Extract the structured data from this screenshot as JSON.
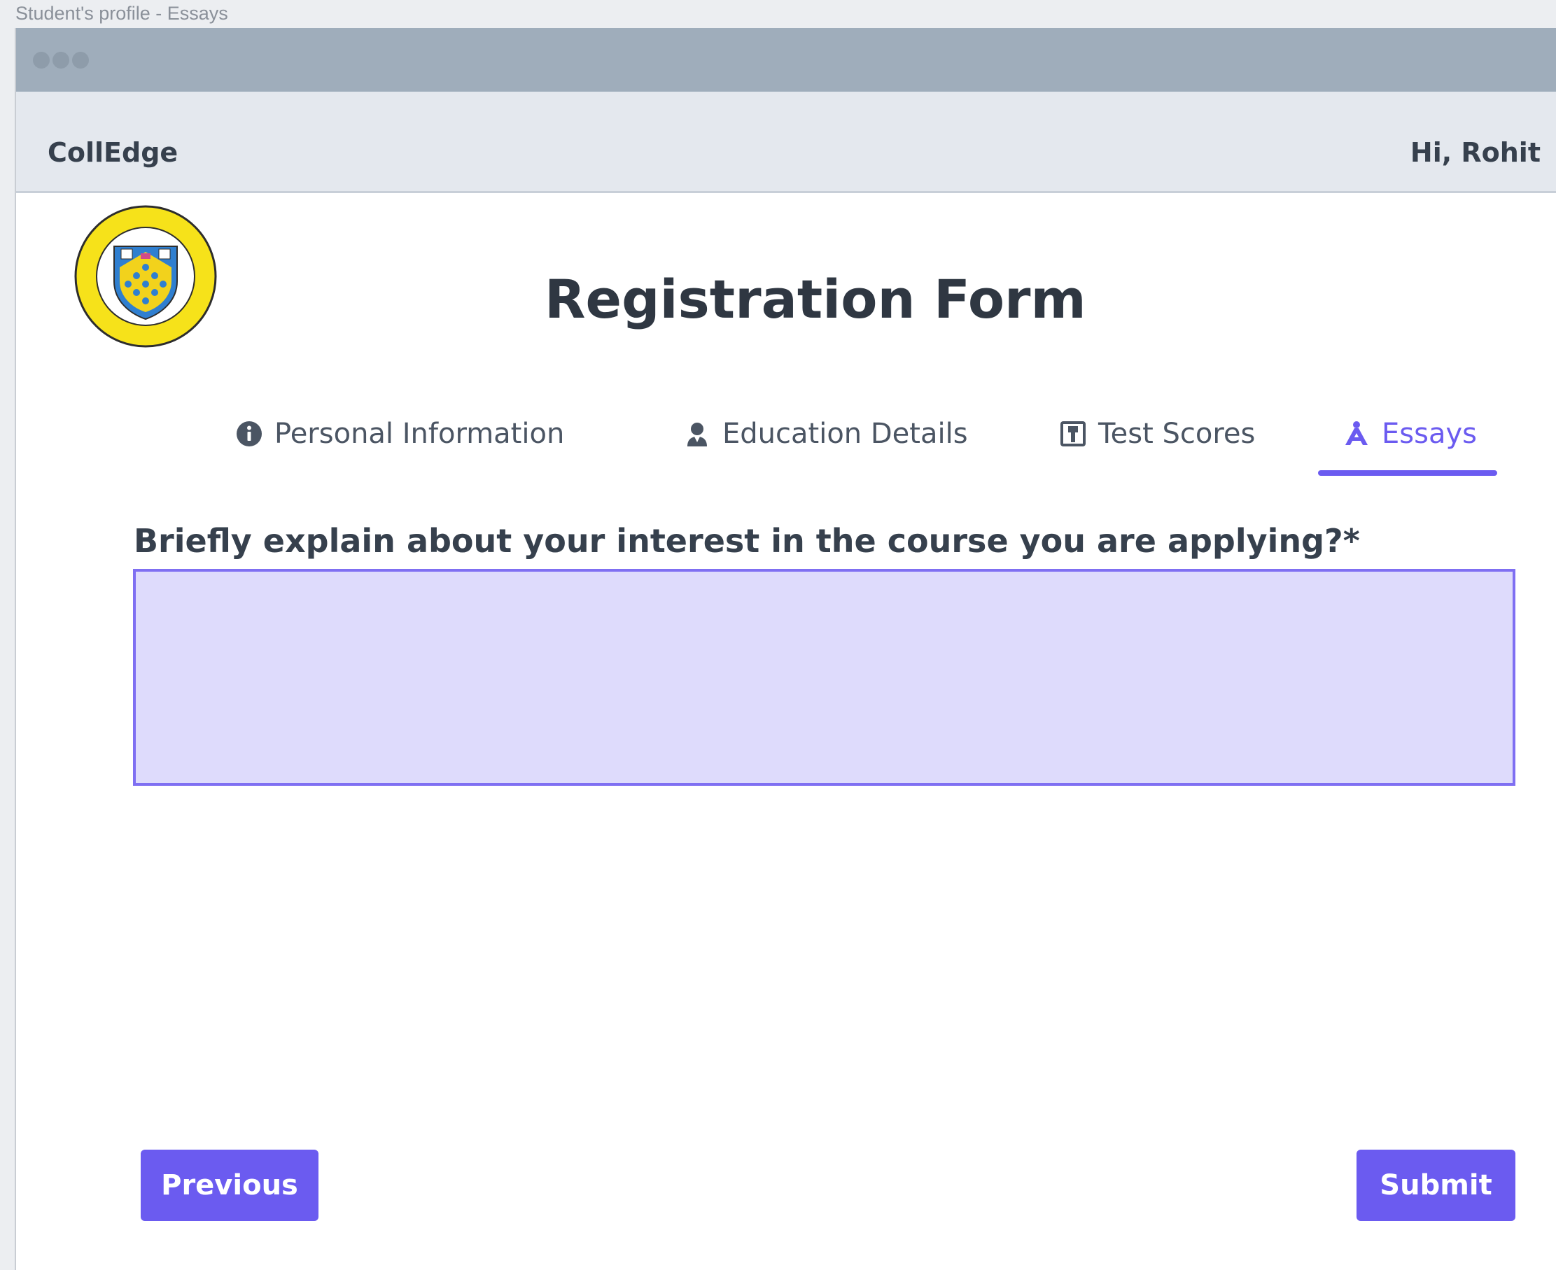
{
  "document_caption": "Student's profile - Essays",
  "app": {
    "brand": "CollEdge",
    "greeting": "Hi, Rohit"
  },
  "page": {
    "title": "Registration Form"
  },
  "tabs": [
    {
      "label": "Personal Information",
      "icon": "info-circle-icon",
      "active": false
    },
    {
      "label": "Education Details",
      "icon": "graduate-icon",
      "active": false
    },
    {
      "label": "Test Scores",
      "icon": "score-card-icon",
      "active": false
    },
    {
      "label": "Essays",
      "icon": "essay-icon",
      "active": true
    }
  ],
  "essay": {
    "question": "Briefly explain about your interest in the course you are applying?*",
    "value": ""
  },
  "buttons": {
    "previous": "Previous",
    "submit": "Submit"
  },
  "colors": {
    "accent": "#6b5bf0",
    "input_fill": "#dedbfc",
    "titlebar": "#9fadbb",
    "appbar": "#e4e8ee"
  }
}
